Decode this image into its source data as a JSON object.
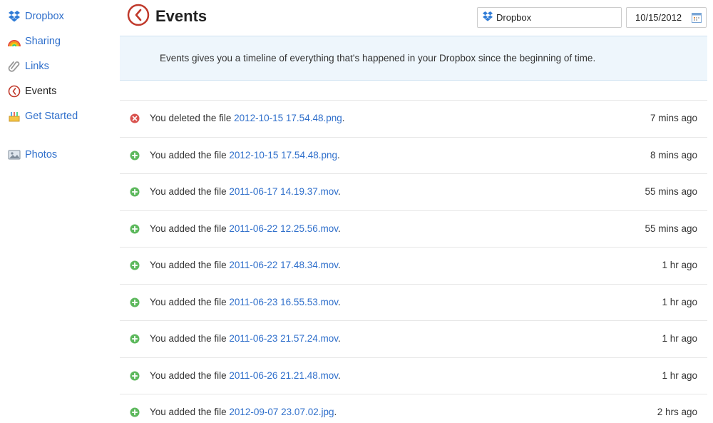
{
  "sidebar": {
    "items": [
      {
        "label": "Dropbox",
        "icon": "dropbox-icon"
      },
      {
        "label": "Sharing",
        "icon": "rainbow-icon"
      },
      {
        "label": "Links",
        "icon": "paperclip-icon"
      },
      {
        "label": "Events",
        "icon": "events-clock-icon"
      },
      {
        "label": "Get Started",
        "icon": "cake-icon"
      },
      {
        "label": "Photos",
        "icon": "photos-icon"
      }
    ]
  },
  "header": {
    "title": "Events",
    "folder_filter": "Dropbox",
    "date": "10/15/2012"
  },
  "banner": {
    "text": "Events gives you a timeline of everything that's happened in your Dropbox since the beginning of time."
  },
  "events": [
    {
      "type": "deleted",
      "prefix": "You deleted the file ",
      "file": "2012-10-15 17.54.48.png",
      "suffix": ".",
      "time": "7 mins ago"
    },
    {
      "type": "added",
      "prefix": "You added the file ",
      "file": "2012-10-15 17.54.48.png",
      "suffix": ".",
      "time": "8 mins ago"
    },
    {
      "type": "added",
      "prefix": "You added the file ",
      "file": "2011-06-17 14.19.37.mov",
      "suffix": ".",
      "time": "55 mins ago"
    },
    {
      "type": "added",
      "prefix": "You added the file ",
      "file": "2011-06-22 12.25.56.mov",
      "suffix": ".",
      "time": "55 mins ago"
    },
    {
      "type": "added",
      "prefix": "You added the file ",
      "file": "2011-06-22 17.48.34.mov",
      "suffix": ".",
      "time": "1 hr ago"
    },
    {
      "type": "added",
      "prefix": "You added the file ",
      "file": "2011-06-23 16.55.53.mov",
      "suffix": ".",
      "time": "1 hr ago"
    },
    {
      "type": "added",
      "prefix": "You added the file ",
      "file": "2011-06-23 21.57.24.mov",
      "suffix": ".",
      "time": "1 hr ago"
    },
    {
      "type": "added",
      "prefix": "You added the file ",
      "file": "2011-06-26 21.21.48.mov",
      "suffix": ".",
      "time": "1 hr ago"
    },
    {
      "type": "added",
      "prefix": "You added the file ",
      "file": "2012-09-07 23.07.02.jpg",
      "suffix": ".",
      "time": "2 hrs ago"
    }
  ],
  "colors": {
    "link": "#2f6fcb",
    "added": "#5cb85c",
    "deleted": "#d9534f",
    "banner_bg": "#eef6fc"
  }
}
